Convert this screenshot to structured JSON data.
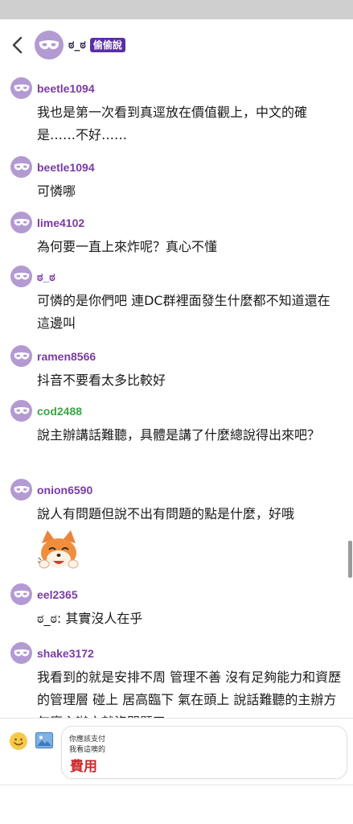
{
  "header": {
    "back_icon": "chevron-left-icon",
    "avatar_icon": "mask-icon",
    "name": "ಠ_ಠ",
    "badge": "偷偷說"
  },
  "messages": [
    {
      "username": "beetle1094",
      "text": "我也是第一次看到真逕放在價值觀上，中文的確是……不好……"
    },
    {
      "username": "beetle1094",
      "text": "可憐哪"
    },
    {
      "username": "lime4102",
      "text": "為何要一直上來炸呢？真心不懂"
    },
    {
      "username": "ಠ_ಠ",
      "text": "可憐的是你們吧 連DC群裡面發生什麼都不知道還在這邊叫"
    },
    {
      "username": "ramen8566",
      "text": "抖音不要看太多比較好"
    },
    {
      "username": "cod2488",
      "text": "說主辦講話難聽，具體是講了什麼總說得出來吧？"
    },
    {
      "username": "onion6590",
      "text": "說人有問題但說不出有問題的點是什麼，好哦",
      "sticker": "fox-sticker"
    },
    {
      "username": "eel2365",
      "text": "ಠ_ಠ: 其實沒人在乎"
    },
    {
      "username": "shake3172",
      "text": "我看到的就是安排不周 管理不善 沒有足夠能力和資歷的管理層 碰上 居高臨下 氣在頭上 說話難聽的主辦方 怎麼主辦方就沒問題了"
    }
  ],
  "composer": {
    "emoji_icon": "smiley-icon",
    "image_icon": "image-icon"
  },
  "ad": {
    "line1": "你應該支付",
    "line2": "我看這噢的",
    "big": "費用"
  },
  "colors": {
    "avatar_bg": "#b39ad3",
    "username_purple": "#7b3aa6",
    "username_green": "#3aa548",
    "badge_bg": "#5a2ea6",
    "ad_red": "#cc2a2a"
  }
}
